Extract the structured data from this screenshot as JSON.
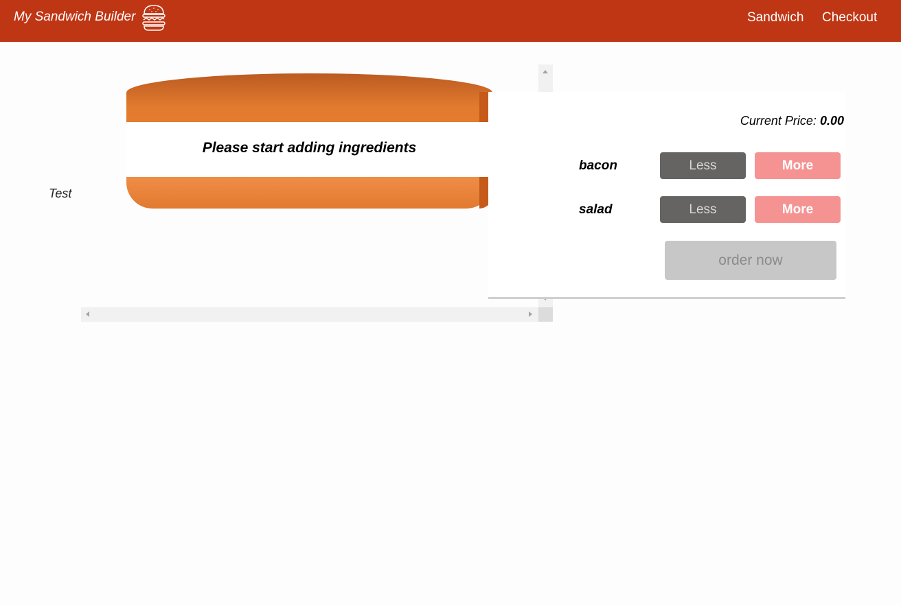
{
  "app": {
    "brand": "My Sandwich Builder",
    "brand_icon": "burger-icon"
  },
  "nav": {
    "items": [
      {
        "label": "Sandwich"
      },
      {
        "label": "Checkout"
      }
    ]
  },
  "side_label": "Test",
  "sandwich": {
    "message": "Please start adding ingredients"
  },
  "controls": {
    "price_label": "Current Price:",
    "price_value": "0.00",
    "ingredients": [
      {
        "name": "bacon",
        "less_label": "Less",
        "more_label": "More"
      },
      {
        "name": "salad",
        "less_label": "Less",
        "more_label": "More"
      }
    ],
    "order_label": "order now"
  },
  "colors": {
    "navbar": "#bf3614",
    "bun": "#e37b2f",
    "less_button": "#666463",
    "more_button": "#f59393",
    "order_button_disabled": "#c8c7c7"
  }
}
